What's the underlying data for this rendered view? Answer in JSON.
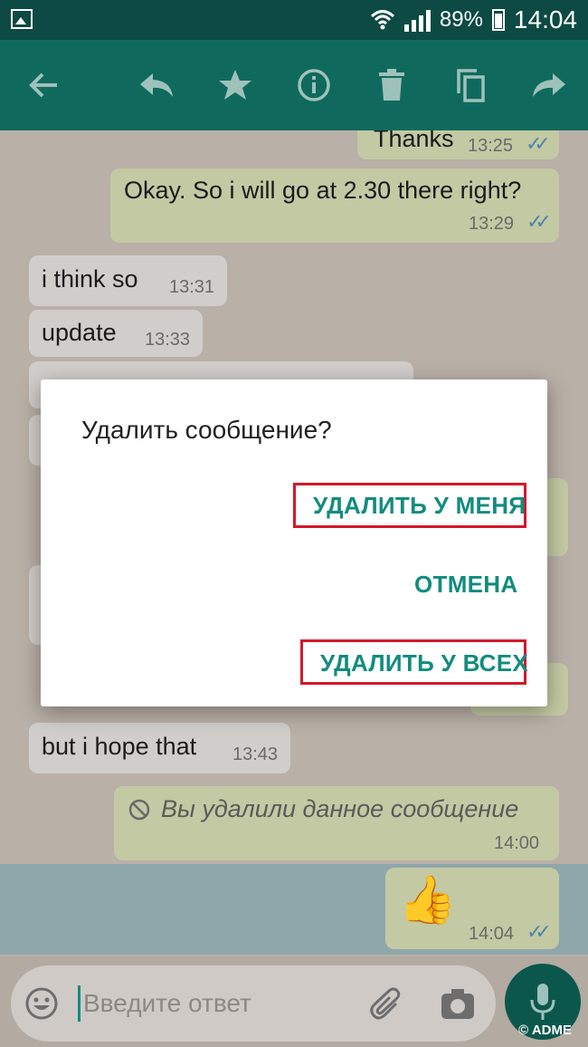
{
  "status_bar": {
    "battery": "89%",
    "time": "14:04"
  },
  "toolbar": {
    "icons": [
      "back-arrow-icon",
      "reply-icon",
      "star-icon",
      "info-icon",
      "delete-icon",
      "copy-icon",
      "forward-icon"
    ]
  },
  "messages": [
    {
      "dir": "out",
      "text": "Thanks",
      "time": "13:25",
      "read": true
    },
    {
      "dir": "out",
      "text": "Okay. So i will go at 2.30 there right?",
      "time": "13:29",
      "read": true
    },
    {
      "dir": "in",
      "text": "i think so",
      "time": "13:31"
    },
    {
      "dir": "in",
      "text": "update",
      "time": "13:33"
    },
    {
      "dir": "in",
      "text": "but i hope that",
      "time": "13:43"
    },
    {
      "dir": "out",
      "text": "Вы удалили данное сообщение",
      "time": "14:00",
      "deleted": true
    },
    {
      "dir": "out",
      "text": "👍",
      "time": "14:04",
      "read": true,
      "selected": true
    }
  ],
  "input": {
    "placeholder": "Введите ответ"
  },
  "dialog": {
    "title": "Удалить сообщение?",
    "delete_for_me": "УДАЛИТЬ У МЕНЯ",
    "cancel": "ОТМЕНА",
    "delete_for_all": "УДАЛИТЬ У ВСЕХ"
  },
  "watermark": "© ADME",
  "colors": {
    "accent": "#128c7e",
    "toolbar": "#0f6a5d",
    "highlight": "#d3182b"
  }
}
